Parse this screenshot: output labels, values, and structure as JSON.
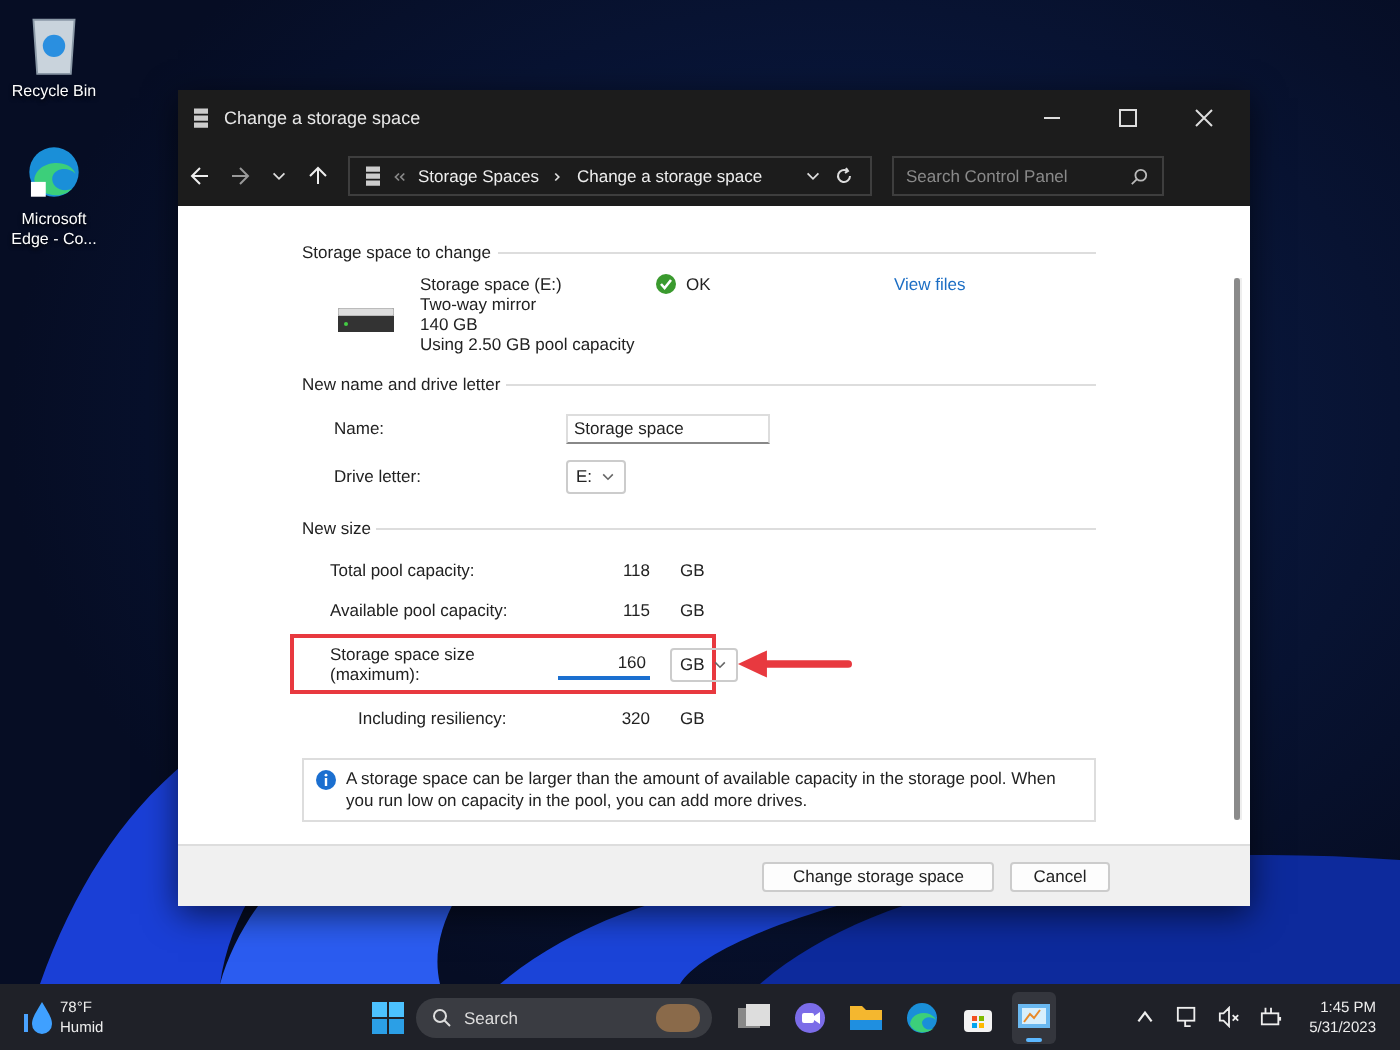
{
  "desktop_icons": [
    {
      "label": "Recycle Bin",
      "kind": "recycle"
    },
    {
      "label": "Microsoft Edge - Co...",
      "kind": "edge"
    }
  ],
  "window": {
    "title": "Change a storage space",
    "breadcrumb": [
      "Storage Spaces",
      "Change a storage space"
    ],
    "search": {
      "placeholder": "Search Control Panel"
    }
  },
  "storage_section": {
    "heading": "Storage space to change",
    "lines": [
      "Storage space (E:)",
      "Two-way mirror",
      "140 GB",
      "Using 2.50 GB pool capacity"
    ],
    "status": "OK",
    "link": "View files"
  },
  "name_section": {
    "heading": "New name and drive letter",
    "name_label": "Name:",
    "name_value": "Storage space",
    "drive_label": "Drive letter:",
    "drive_value": "E:"
  },
  "size_section": {
    "heading": "New size",
    "rows": [
      {
        "kind": "static",
        "label": "Total pool capacity:",
        "value": "118",
        "unit": "GB",
        "highlighted": false
      },
      {
        "kind": "static",
        "label": "Available pool capacity:",
        "value": "115",
        "unit": "GB",
        "highlighted": false
      },
      {
        "kind": "input",
        "label": "Storage space size (maximum):",
        "value": "160",
        "unit": "GB",
        "highlighted": true
      },
      {
        "kind": "indented",
        "label": "Including resiliency:",
        "value": "320",
        "unit": "GB",
        "highlighted": false
      }
    ]
  },
  "info": "A storage space can be larger than the amount of available capacity in the storage pool. When you run low on capacity in the pool, you can add more drives.",
  "buttons": [
    "Change storage space",
    "Cancel"
  ],
  "taskbar": {
    "weather": {
      "temperature": "78°F",
      "condition": "Humid"
    },
    "search": {
      "placeholder": "Search"
    },
    "apps": [
      {
        "kind": "taskview",
        "active": false
      },
      {
        "kind": "chat",
        "active": false
      },
      {
        "kind": "folder",
        "active": false
      },
      {
        "kind": "edge",
        "active": false
      },
      {
        "kind": "store",
        "active": false
      },
      {
        "kind": "control",
        "active": true
      }
    ],
    "time": "1:45 PM",
    "date": "5/31/2023"
  }
}
